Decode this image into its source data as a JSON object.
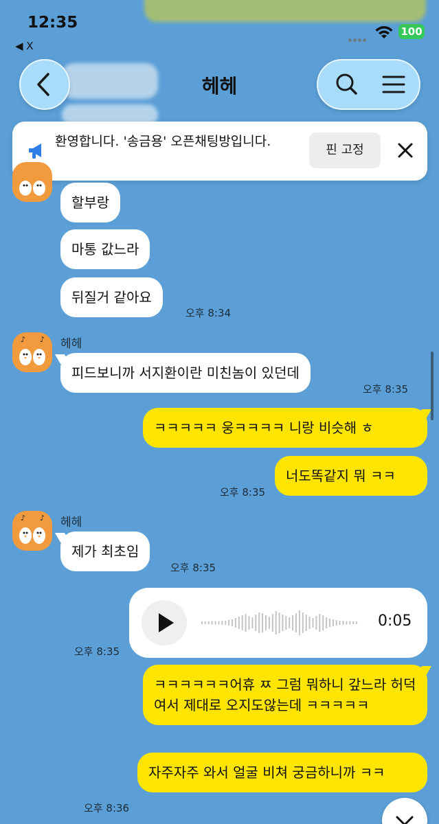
{
  "status": {
    "time": "12:35",
    "back_app": "◀ X",
    "battery": "100"
  },
  "header": {
    "title": "헤헤"
  },
  "notice": {
    "text": "환영합니다. '송금용' 오픈채팅방입니다.",
    "pin_label": "핀 고정"
  },
  "colors": {
    "background": "#5b9fd6",
    "outgoing": "#fee500",
    "incoming": "#ffffff",
    "header_button": "#a9dcfb"
  },
  "messages": {
    "m1": "할부랑",
    "m2": "마통 값느라",
    "m3": "뒤질거 같아요",
    "t1": "오후 8:34",
    "sender2": "헤헤",
    "m4": "피드보니까 서지환이란 미친놈이 있던데",
    "t2": "오후 8:35",
    "m5": "ㅋㅋㅋㅋㅋ 웅ㅋㅋㅋㅋ 니랑 비슷해 ㅎ",
    "m6": "너도똑같지 뭐 ㅋㅋ",
    "t3": "오후 8:35",
    "sender3": "헤헤",
    "m7": "제가 최초임",
    "t4": "오후 8:35",
    "voice_duration": "0:05",
    "t5": "오후 8:35",
    "m8": "ㅋㅋㅋㅋㅋㅋ어휴 ㅉ 그럼 뭐하니 갚느라 허덕여서 제대로 오지도않는데 ㅋㅋㅋㅋㅋ",
    "m9": "자주자주 와서 얼굴 비쳐 궁금하니까 ㅋㅋ",
    "t6": "오후 8:36"
  },
  "icons": {
    "back": "chevron-left-icon",
    "search": "search-icon",
    "menu": "hamburger-menu-icon",
    "notice": "megaphone-icon",
    "close": "close-icon",
    "play": "play-icon",
    "scroll_down": "chevron-down-icon"
  }
}
